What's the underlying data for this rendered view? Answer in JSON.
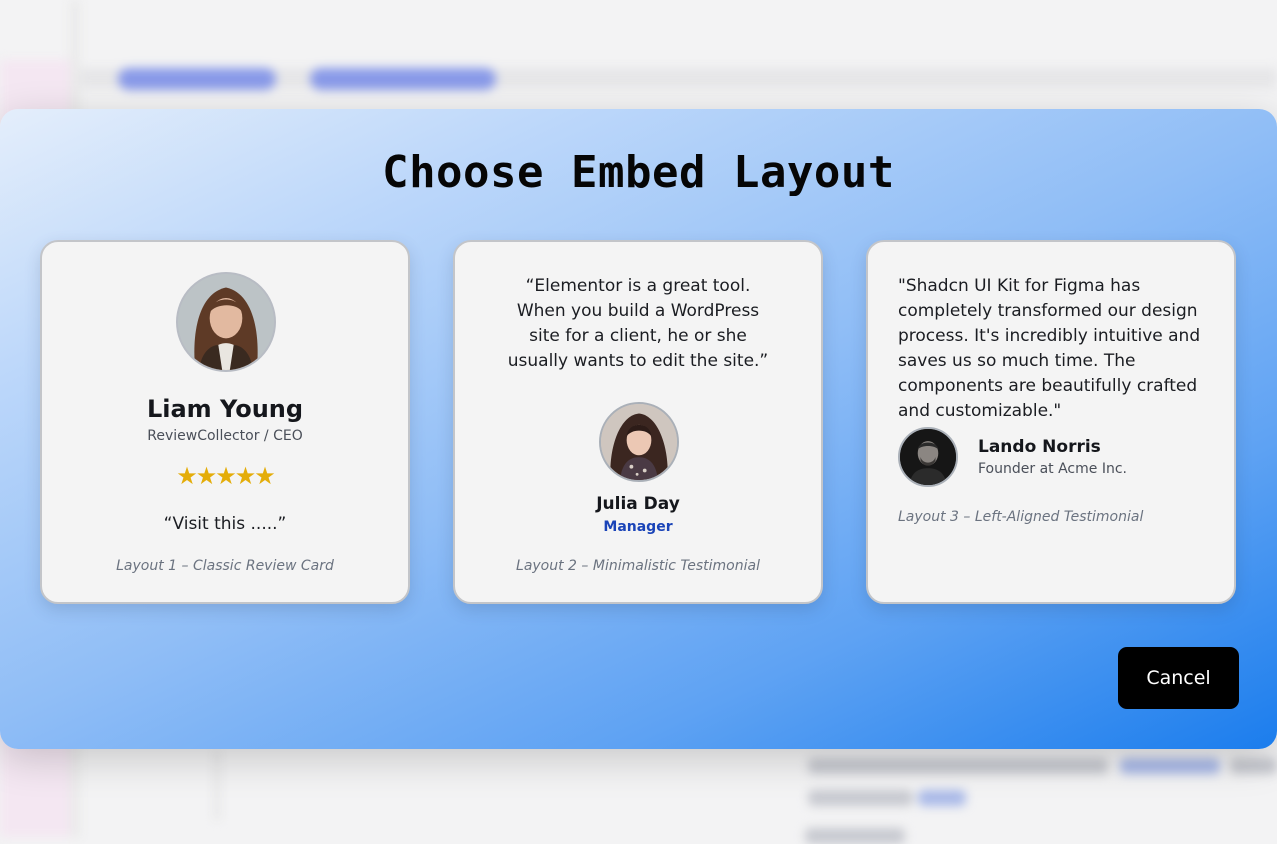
{
  "modal": {
    "title": "Choose Embed Layout",
    "cancel_label": "Cancel"
  },
  "layouts": [
    {
      "name": "Liam Young",
      "role": "ReviewCollector / CEO",
      "rating": 5,
      "stars": "★★★★★",
      "quote": "“Visit this .....”",
      "caption": "Layout 1 – Classic Review Card",
      "avatar_icon": "person-photo-avatar"
    },
    {
      "quote": "“Elementor is a great tool. When you build a WordPress site for a client, he or she usually wants to edit the site.”",
      "name": "Julia Day",
      "role": "Manager",
      "caption": "Layout 2 – Minimalistic Testimonial",
      "avatar_icon": "person-photo-avatar"
    },
    {
      "quote": "\"Shadcn UI Kit for Figma has completely transformed our design process. It's incredibly intuitive and saves us so much time. The components are beautifully crafted and customizable.\"",
      "name": "Lando Norris",
      "role": "Founder at Acme Inc.",
      "caption": "Layout 3 – Left-Aligned Testimonial",
      "avatar_icon": "person-photo-avatar"
    }
  ],
  "colors": {
    "star": "#e4ad09",
    "role_accent": "#1a44b8",
    "cancel_bg": "#000000",
    "modal_gradient_end": "#1b7ded"
  }
}
